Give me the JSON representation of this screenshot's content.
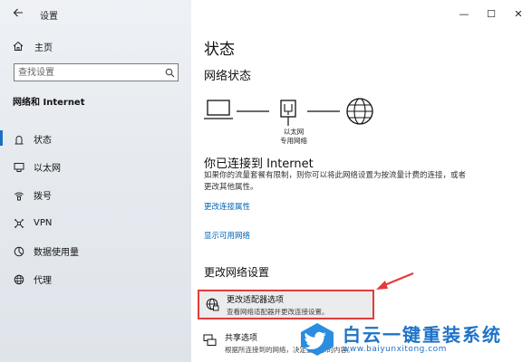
{
  "window": {
    "title": "设置",
    "controls": {
      "minimize": "—",
      "maximize": "☐",
      "close": "✕"
    }
  },
  "sidebar": {
    "back_icon": "back-arrow-icon",
    "home_label": "主页",
    "search_placeholder": "查找设置",
    "section_title": "网络和 Internet",
    "items": [
      {
        "label": "状态",
        "icon": "status-icon",
        "active": true
      },
      {
        "label": "以太网",
        "icon": "ethernet-icon",
        "active": false
      },
      {
        "label": "拨号",
        "icon": "dialup-icon",
        "active": false
      },
      {
        "label": "VPN",
        "icon": "vpn-icon",
        "active": false
      },
      {
        "label": "数据使用量",
        "icon": "data-usage-icon",
        "active": false
      },
      {
        "label": "代理",
        "icon": "proxy-icon",
        "active": false
      }
    ]
  },
  "main": {
    "page_title": "状态",
    "network_status_title": "网络状态",
    "diagram": {
      "label_line1": "以太网",
      "label_line2": "专用网络"
    },
    "connected_title": "你已连接到 Internet",
    "connected_desc": "如果你的流量套餐有限制，则你可以将此网络设置为按流量计费的连接，或者更改其他属性。",
    "link_change_props": "更改连接属性",
    "link_show_networks": "显示可用网络",
    "change_settings_title": "更改网络设置",
    "adapter_option": {
      "title": "更改适配器选项",
      "desc": "查看网络适配器并更改连接设置。"
    },
    "sharing_option": {
      "title": "共享选项",
      "desc": "根据所连接到的网络，决定要共享的内容。"
    }
  },
  "watermark": {
    "brand": "白云一键重装系统",
    "url": "www.baiyunxitong.com"
  },
  "colors": {
    "accent": "#0063b1",
    "active_bar": "#1a6fc4",
    "highlight_border": "#e23b3b",
    "watermark": "#1e73c8"
  }
}
